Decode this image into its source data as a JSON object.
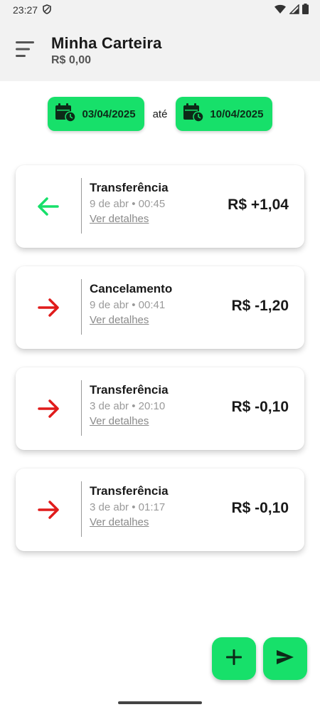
{
  "status": {
    "time": "23:27"
  },
  "header": {
    "title": "Minha Carteira",
    "balance": "R$ 0,00"
  },
  "filter": {
    "start_date": "03/04/2025",
    "separator": "até",
    "end_date": "10/04/2025"
  },
  "transactions": [
    {
      "type": "Transferência",
      "datetime": "9 de abr • 00:45",
      "link": "Ver detalhes",
      "amount": "R$ +1,04",
      "direction": "in"
    },
    {
      "type": "Cancelamento",
      "datetime": "9 de abr • 00:41",
      "link": "Ver detalhes",
      "amount": "R$ -1,20",
      "direction": "out"
    },
    {
      "type": "Transferência",
      "datetime": "3 de abr • 20:10",
      "link": "Ver detalhes",
      "amount": "R$ -0,10",
      "direction": "out"
    },
    {
      "type": "Transferência",
      "datetime": "3 de abr • 01:17",
      "link": "Ver detalhes",
      "amount": "R$ -0,10",
      "direction": "out"
    }
  ],
  "colors": {
    "accent": "#17e06a",
    "incoming": "#17e06a",
    "outgoing": "#e01b1b",
    "background": "#ffffff",
    "header_bg": "#f2f2f2"
  },
  "icons": {
    "menu": "menu-icon",
    "calendar": "calendar-clock-icon",
    "add": "plus-icon",
    "send": "send-icon",
    "incoming": "arrow-left-icon",
    "outgoing": "arrow-right-icon"
  }
}
